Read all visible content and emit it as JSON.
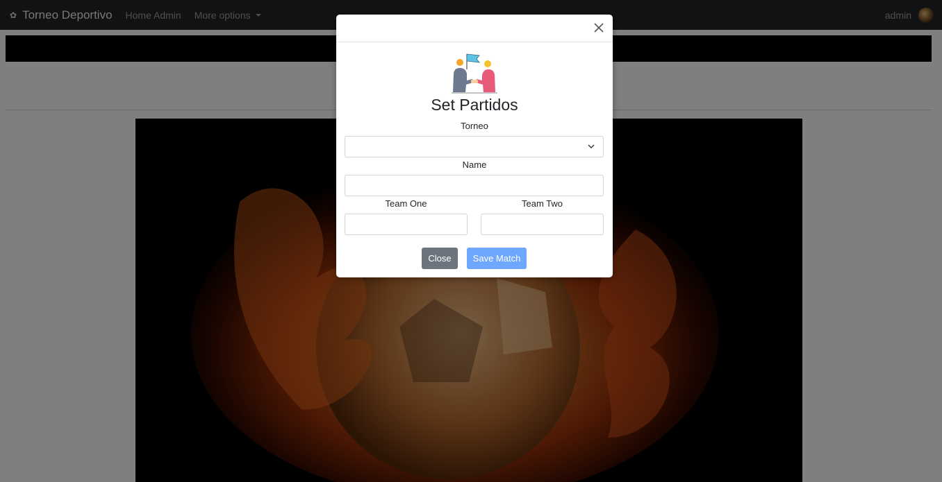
{
  "navbar": {
    "brand": "Torneo Deportivo",
    "links": [
      "Home Admin",
      "More options"
    ],
    "user": "admin"
  },
  "modal": {
    "title": "Set Partidos",
    "fields": {
      "torneo_label": "Torneo",
      "torneo_value": "",
      "name_label": "Name",
      "name_value": "",
      "team_one_label": "Team One",
      "team_one_value": "",
      "team_two_label": "Team Two",
      "team_two_value": ""
    },
    "buttons": {
      "close": "Close",
      "save": "Save Match"
    }
  },
  "colors": {
    "navbar": "#212529",
    "save_button": "#6ea8fe",
    "close_button": "#6c757d"
  },
  "icons": [
    "flower-icon",
    "chevron-down-icon",
    "close-icon",
    "handshake-illustration"
  ]
}
